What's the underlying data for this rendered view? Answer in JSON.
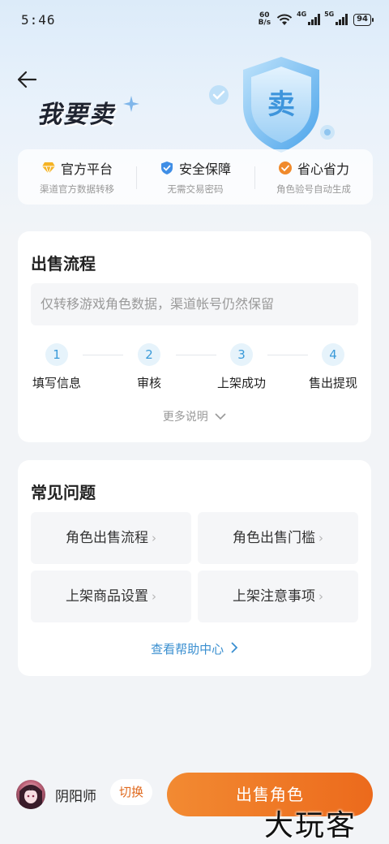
{
  "status_bar": {
    "time": "5:46",
    "net_speed_value": "60",
    "net_speed_unit": "B/s",
    "signal1_label": "4G",
    "signal2_label": "5G",
    "battery": "94"
  },
  "header": {
    "title": "我要卖",
    "shield_char": "卖"
  },
  "features": [
    {
      "name": "官方平台",
      "desc": "渠道官方数据转移",
      "icon": "diamond-icon",
      "color": "#f5b324"
    },
    {
      "name": "安全保障",
      "desc": "无需交易密码",
      "icon": "shield-check-icon",
      "color": "#3f8ee6"
    },
    {
      "name": "省心省力",
      "desc": "角色验号自动生成",
      "icon": "check-circle-icon",
      "color": "#f08a2c"
    }
  ],
  "process": {
    "title": "出售流程",
    "notice": "仅转移游戏角色数据，渠道帐号仍然保留",
    "steps": [
      {
        "num": "1",
        "label": "填写信息"
      },
      {
        "num": "2",
        "label": "审核"
      },
      {
        "num": "3",
        "label": "上架成功"
      },
      {
        "num": "4",
        "label": "售出提现"
      }
    ],
    "more": "更多说明"
  },
  "faq": {
    "title": "常见问题",
    "items": [
      "角色出售流程",
      "角色出售门槛",
      "上架商品设置",
      "上架注意事项"
    ],
    "help_link": "查看帮助中心"
  },
  "bottom": {
    "game_name": "阴阳师",
    "switch_label": "切换",
    "sell_label": "出售角色"
  },
  "watermark": "大玩客",
  "colors": {
    "accent_orange": "#ec6a1c",
    "link_blue": "#3a8fd0",
    "step_blue": "#3a9ad9"
  }
}
